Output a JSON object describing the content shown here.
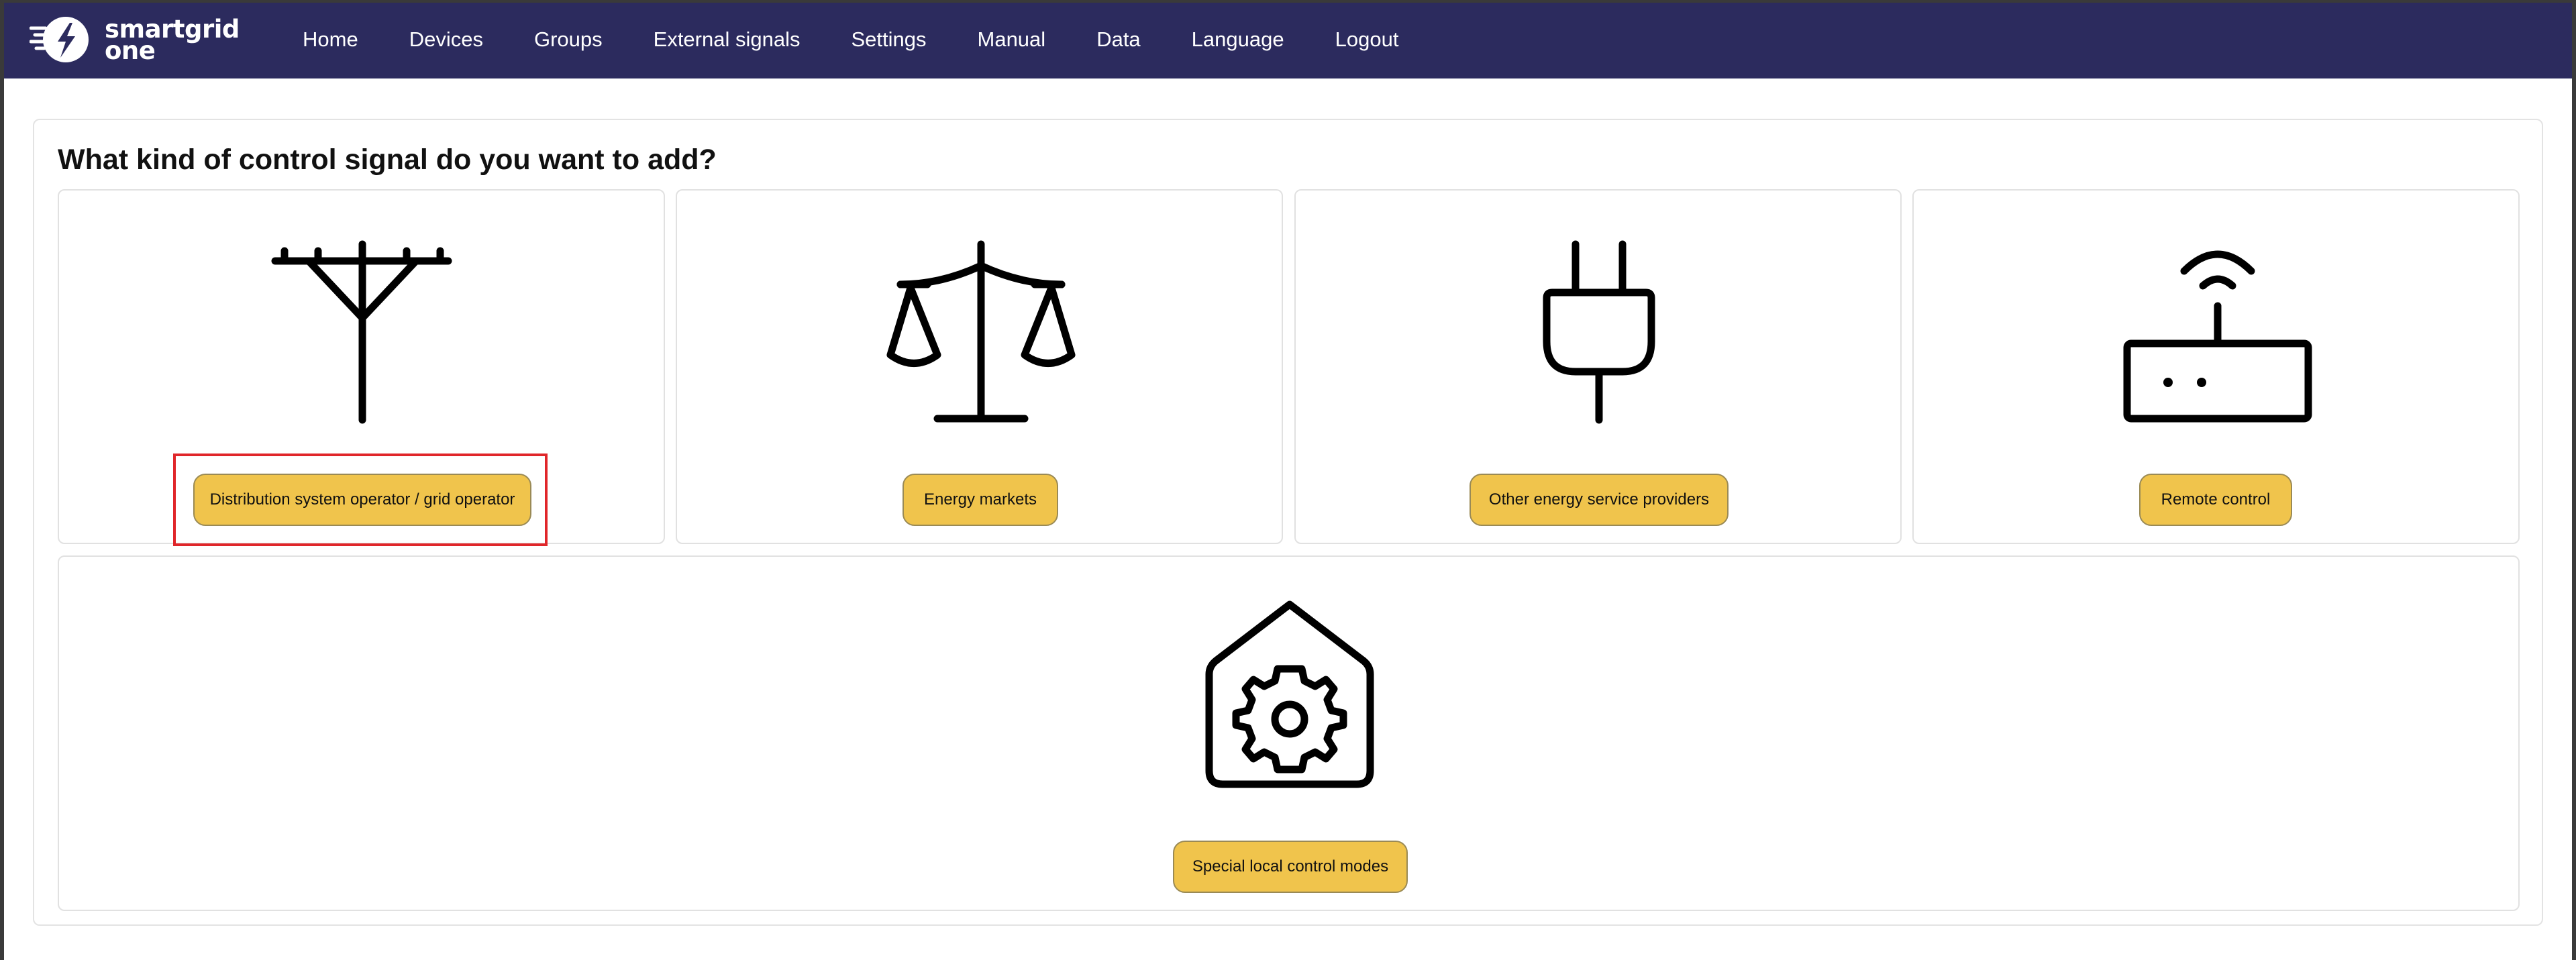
{
  "app": {
    "logo_line1": "smartgrid",
    "logo_line2": "one"
  },
  "nav": {
    "items": [
      "Home",
      "Devices",
      "Groups",
      "External signals",
      "Settings",
      "Manual",
      "Data",
      "Language",
      "Logout"
    ]
  },
  "page": {
    "heading": "What kind of control signal do you want to add?"
  },
  "options": [
    {
      "label": "Distribution system operator / grid operator",
      "icon": "power-pole-icon",
      "selected": true
    },
    {
      "label": "Energy markets",
      "icon": "scales-icon"
    },
    {
      "label": "Other energy service providers",
      "icon": "plug-icon"
    },
    {
      "label": "Remote control",
      "icon": "router-icon"
    },
    {
      "label": "Special local control modes",
      "icon": "home-gear-icon"
    }
  ],
  "colors": {
    "navbar": "#2c2b5e",
    "button": "#f0c44c",
    "highlight": "#e0262a"
  }
}
